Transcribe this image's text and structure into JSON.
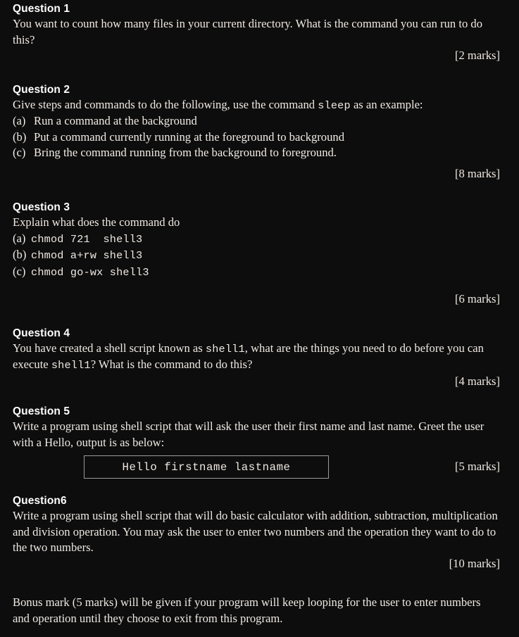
{
  "document": {
    "background_color": "#0d0d0d",
    "text_color": "#efe9e3",
    "heading_color": "#ffffff",
    "box_border_color": "#9a9a9a"
  },
  "questions": [
    {
      "heading": "Question 1",
      "body": "You want to count how many files in your current directory. What is the command you can run to do this?",
      "marks": "[2 marks]"
    },
    {
      "heading": "Question 2",
      "intro_before": "Give steps and commands to do the following, use the command ",
      "intro_code": "sleep",
      "intro_after": " as an example:",
      "items": [
        {
          "label": "(a)",
          "text": "Run a command at the background"
        },
        {
          "label": "(b)",
          "text": "Put a command currently running at the foreground to background"
        },
        {
          "label": "(c)",
          "text": "Bring the command running from the background to foreground."
        }
      ],
      "marks": "[8 marks]"
    },
    {
      "heading": "Question 3",
      "body": "Explain what does the command do",
      "items": [
        {
          "label": "(a)",
          "code": "chmod 721  shell3"
        },
        {
          "label": "(b)",
          "code": "chmod a+rw shell3"
        },
        {
          "label": "(c)",
          "code": "chmod go-wx shell3"
        }
      ],
      "marks": "[6 marks]"
    },
    {
      "heading": "Question 4",
      "part1": "You have created a shell script known as ",
      "code1": "shell1",
      "part2": ",  what are the things you need to do before you can execute ",
      "code2": "shell1",
      "part3": "?  What is the command to do this?",
      "marks": "[4 marks]"
    },
    {
      "heading": "Question 5",
      "body": "Write a program using shell script that will ask the user their first name and last name. Greet the user with a Hello, output is as below:",
      "output_box": "Hello firstname lastname",
      "marks": "[5 marks]"
    },
    {
      "heading": "Question6",
      "body": "Write a program using shell script that will do basic calculator with addition, subtraction, multiplication and division operation. You may ask the user to enter two numbers and the operation they want to do to the two numbers.",
      "marks": "[10 marks]",
      "bonus": "Bonus mark (5 marks) will be given if your program will keep looping for the user to enter numbers and operation until they choose to exit from this program."
    }
  ]
}
